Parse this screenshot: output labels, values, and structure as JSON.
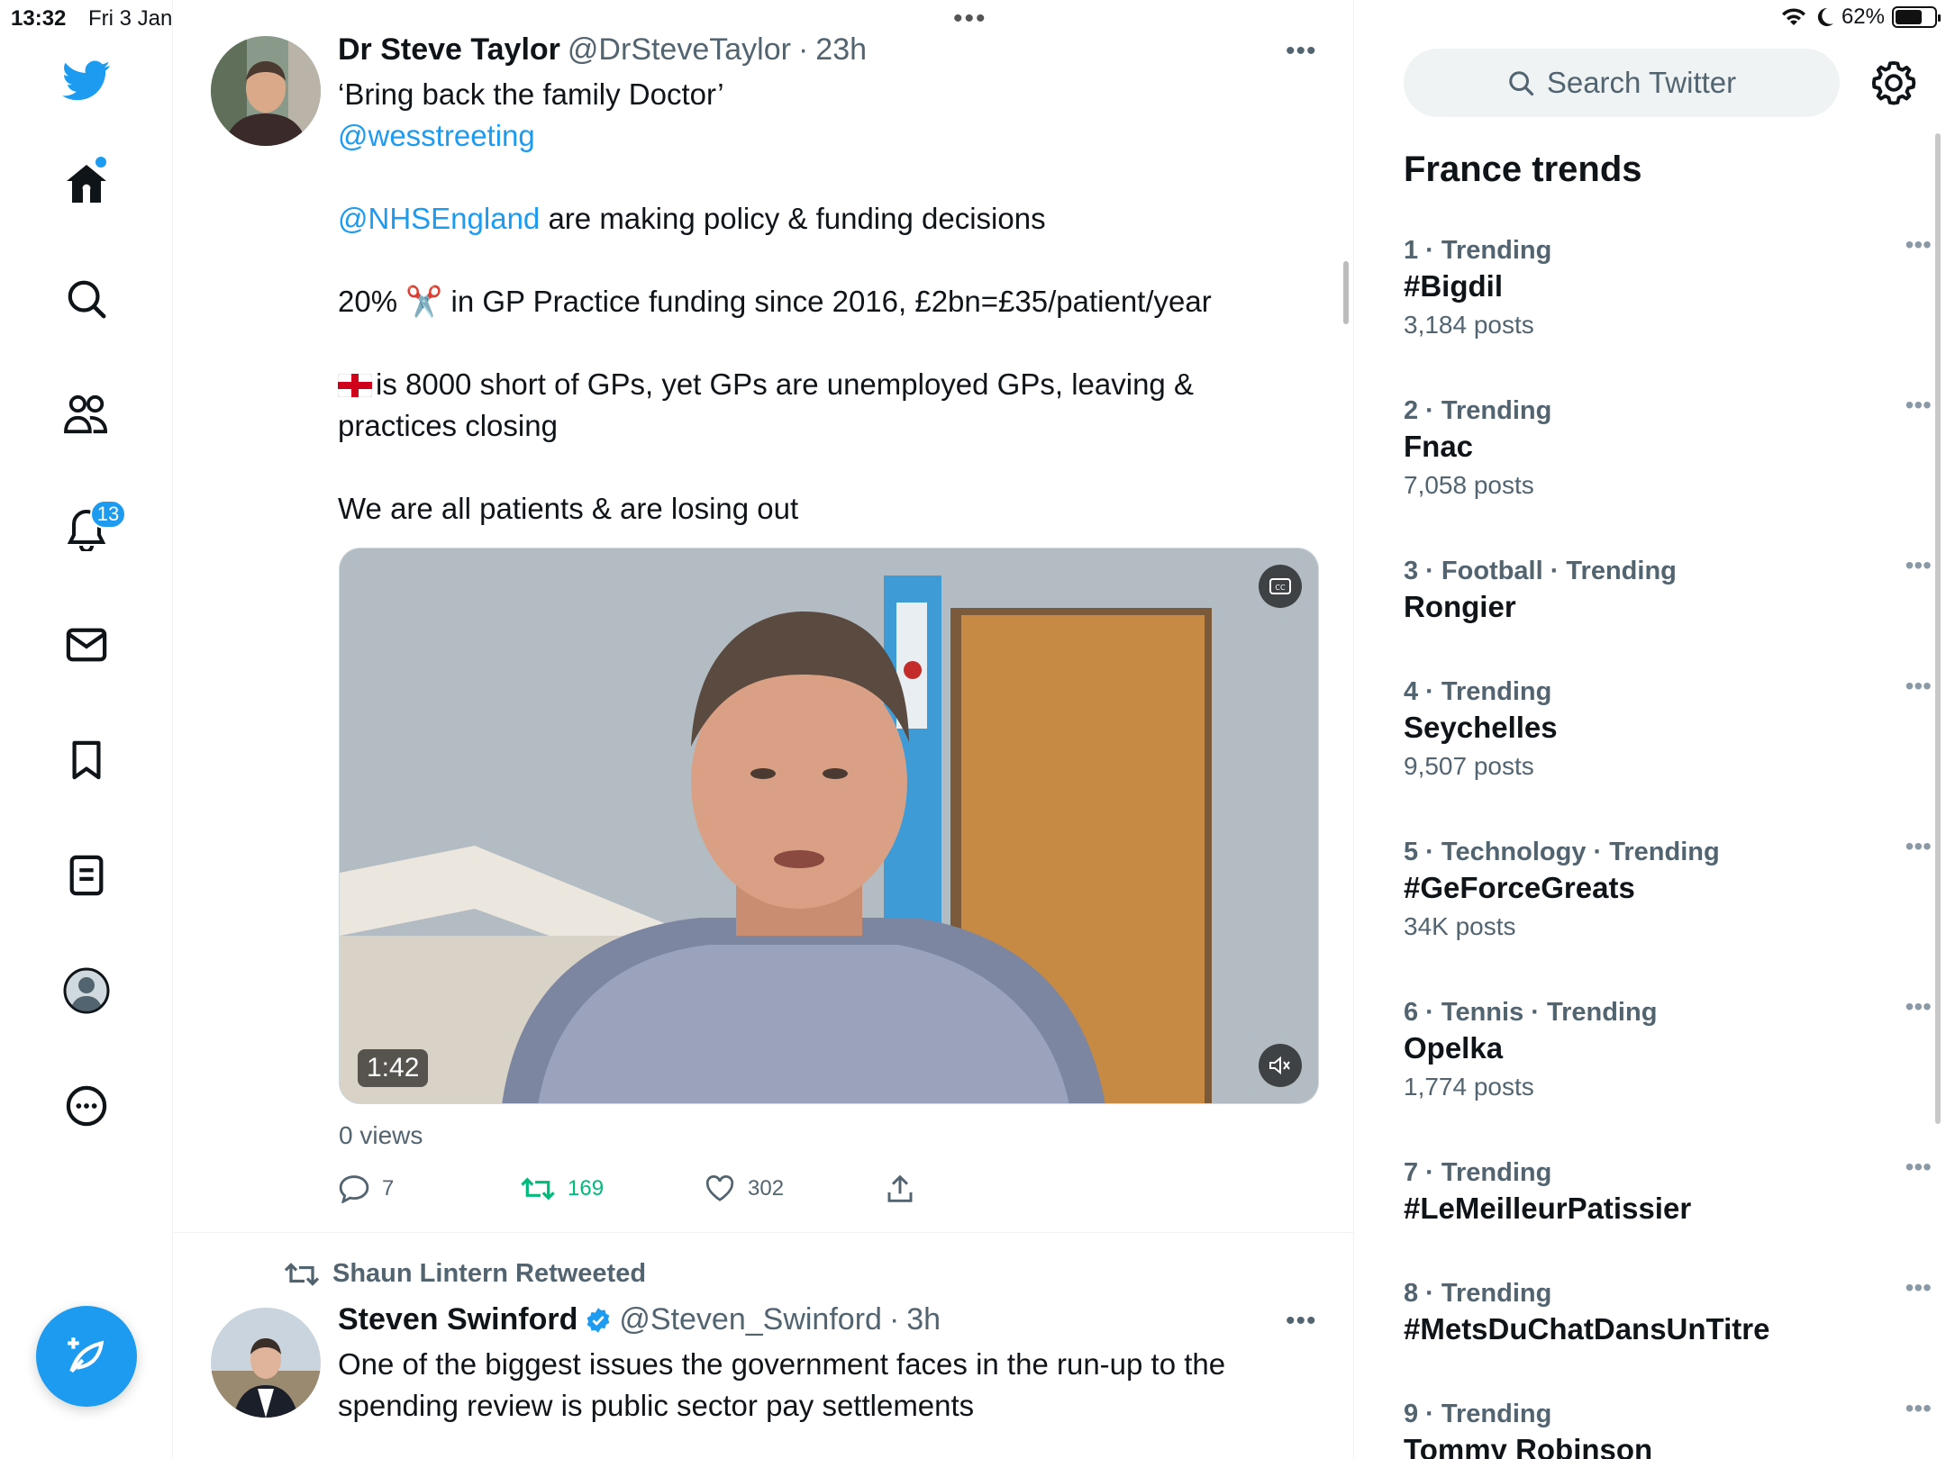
{
  "status_bar": {
    "time": "13:32",
    "date": "Fri 3 Jan",
    "battery": "62%",
    "battery_level": 0.62
  },
  "nav": {
    "icons": [
      "twitter-logo-icon",
      "home-icon",
      "search-icon",
      "communities-icon",
      "notifications-icon",
      "messages-icon",
      "bookmarks-icon",
      "lists-icon",
      "profile-icon",
      "more-icon"
    ],
    "notifications_badge": "13"
  },
  "tweet1": {
    "name": "Dr Steve Taylor",
    "handle": "@DrSteveTaylor",
    "separator": "·",
    "time": "23h",
    "line1": "‘Bring back the family Doctor’",
    "mention1": "@wesstreeting",
    "mention2": "@NHSEngland",
    "line3_rest": " are making policy & funding decisions",
    "line4_a": "20% ",
    "line4_emoji": "✂️",
    "line4_b": " in GP Practice funding since 2016, £2bn=£35/patient/year",
    "line5_flag": "🏴",
    "line5": "is 8000 short of GPs, yet GPs are unemployed GPs, leaving & practices closing",
    "line6": "We are all patients & are losing out",
    "video_duration": "1:42",
    "views": "0 views",
    "replies": "7",
    "retweets": "169",
    "likes": "302",
    "retweet_color": "#00ba7c"
  },
  "tweet2": {
    "retweeted_by": "Shaun Lintern Retweeted",
    "name": "Steven Swinford",
    "handle": "@Steven_Swinford",
    "separator": "·",
    "time": "3h",
    "text": "One of the biggest issues the government faces in the run-up to the spending review is public sector pay settlements"
  },
  "sidebar": {
    "search_placeholder": "Search Twitter",
    "trends_title": "France trends",
    "trends": [
      {
        "meta": "1 · Trending",
        "name": "#Bigdil",
        "count": "3,184 posts"
      },
      {
        "meta": "2 · Trending",
        "name": "Fnac",
        "count": "7,058 posts"
      },
      {
        "meta": "3 · Football · Trending",
        "name": "Rongier",
        "count": ""
      },
      {
        "meta": "4 · Trending",
        "name": "Seychelles",
        "count": "9,507 posts"
      },
      {
        "meta": "5 · Technology · Trending",
        "name": "#GeForceGreats",
        "count": "34K posts"
      },
      {
        "meta": "6 · Tennis · Trending",
        "name": "Opelka",
        "count": "1,774 posts"
      },
      {
        "meta": "7 · Trending",
        "name": "#LeMeilleurPatissier",
        "count": ""
      },
      {
        "meta": "8 · Trending",
        "name": "#MetsDuChatDansUnTitre",
        "count": ""
      },
      {
        "meta": "9 · Trending",
        "name": "Tommy Robinson",
        "count": ""
      }
    ]
  },
  "colors": {
    "accent": "#1d9bf0",
    "text": "#0f1419",
    "muted": "#536471"
  }
}
